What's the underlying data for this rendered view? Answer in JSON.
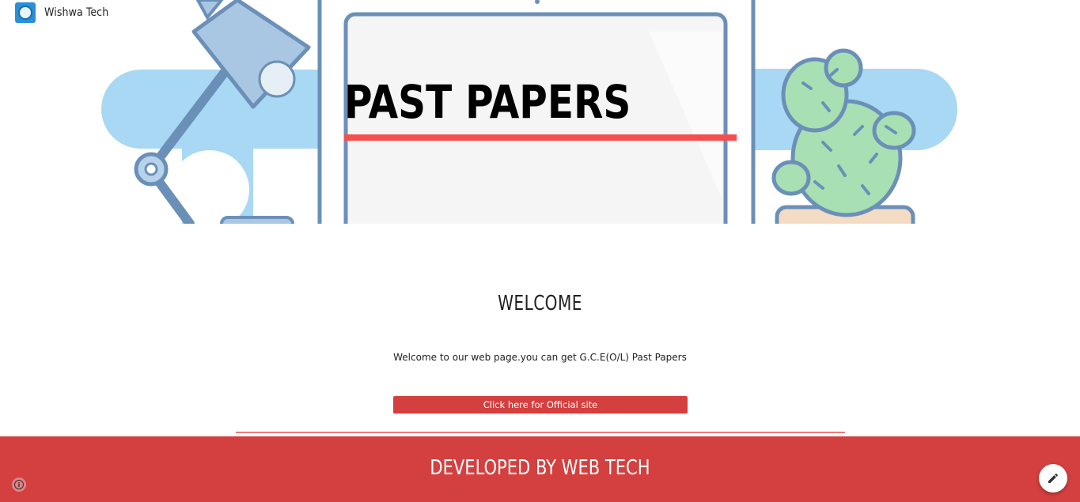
{
  "header": {
    "site_title": "Wishwa Tech",
    "logo_icon": "site-logo-icon"
  },
  "hero": {
    "title": "PAST PAPERS",
    "accent_color": "#f44f4f"
  },
  "main": {
    "heading": "WELCOME",
    "text": "Welcome to our web page.you can get G.C.E(O/L) Past Papers",
    "button_label": "Click here for Official site",
    "button_color": "#d3403f"
  },
  "footer": {
    "text": "DEVELOPED BY WEB TECH",
    "background_color": "#d3403f"
  },
  "controls": {
    "info_icon": "info-icon",
    "edit_icon": "pencil-icon"
  }
}
